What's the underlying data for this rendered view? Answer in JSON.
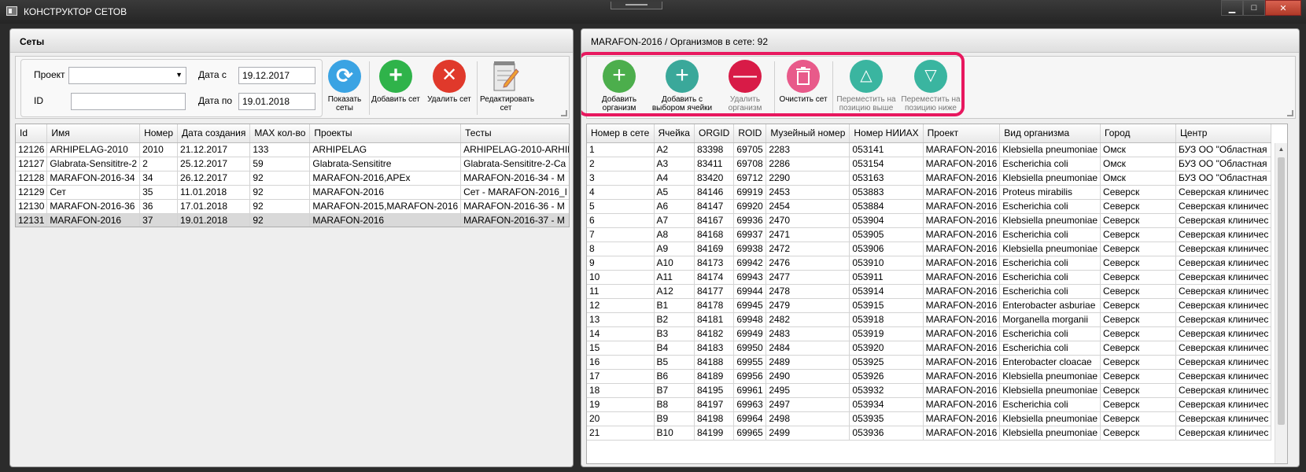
{
  "window": {
    "title": "КОНСТРУКТОР СЕТОВ",
    "controls": {
      "minimize": "▁",
      "maximize": "□",
      "close": "✕"
    }
  },
  "left_panel": {
    "title": "Сеты",
    "filters": {
      "project_label": "Проект",
      "project_value": "",
      "id_label": "ID",
      "id_value": "",
      "date_from_label": "Дата с",
      "date_from_value": "19.12.2017",
      "date_to_label": "Дата по",
      "date_to_value": "19.01.2018"
    },
    "buttons": {
      "show": "Показать сеты",
      "add": "Добавить сет",
      "delete": "Удалить сет",
      "edit": "Редактировать сет"
    },
    "table": {
      "columns": [
        "Id",
        "Имя",
        "Номер",
        "Дата создания",
        "MAX кол-во",
        "Проекты",
        "Тесты"
      ],
      "rows": [
        [
          "12126",
          "ARHIPELAG-2010",
          "2010",
          "21.12.2017",
          "133",
          "ARHIPELAG",
          "ARHIPELAG-2010-ARHIPE"
        ],
        [
          "12127",
          "Glabrata-Sensititre-2",
          "2",
          "25.12.2017",
          "59",
          "Glabrata-Sensititre",
          "Glabrata-Sensititre-2-Ca"
        ],
        [
          "12128",
          "MARAFON-2016-34",
          "34",
          "26.12.2017",
          "92",
          "MARAFON-2016,APEx",
          "MARAFON-2016-34 - M"
        ],
        [
          "12129",
          "Сет",
          "35",
          "11.01.2018",
          "92",
          "MARAFON-2016",
          "Сет  - MARAFON-2016_I"
        ],
        [
          "12130",
          "MARAFON-2016-36",
          "36",
          "17.01.2018",
          "92",
          "MARAFON-2015,MARAFON-2016",
          "MARAFON-2016-36 - M"
        ],
        [
          "12131",
          "MARAFON-2016",
          "37",
          "19.01.2018",
          "92",
          "MARAFON-2016",
          "MARAFON-2016-37 - M"
        ]
      ],
      "selected_row": 5
    }
  },
  "right_panel": {
    "header_set": "MARAFON-2016",
    "header_count": "  / Организмов в сете: 92",
    "buttons": {
      "add_org": "Добавить организм",
      "add_cell": "Добавить с выбором ячейки",
      "delete_org": "Удалить организм",
      "clear": "Очистить сет",
      "move_up": "Переместить на позицию выше",
      "move_down": "Переместить на позицию ниже"
    },
    "table": {
      "columns": [
        "Номер в сете",
        "Ячейка",
        "ORGID",
        "ROID",
        "Музейный номер",
        "Номер НИИАХ",
        "Проект",
        "Вид организма",
        "Город",
        "Центр"
      ],
      "rows": [
        [
          "1",
          "A2",
          "83398",
          "69705",
          "2283",
          "053141",
          "MARAFON-2016",
          "Klebsiella pneumoniae",
          "Омск",
          "БУЗ ОО \"Областная"
        ],
        [
          "2",
          "A3",
          "83411",
          "69708",
          "2286",
          "053154",
          "MARAFON-2016",
          "Escherichia coli",
          "Омск",
          "БУЗ ОО \"Областная"
        ],
        [
          "3",
          "A4",
          "83420",
          "69712",
          "2290",
          "053163",
          "MARAFON-2016",
          "Klebsiella pneumoniae",
          "Омск",
          "БУЗ ОО \"Областная"
        ],
        [
          "4",
          "A5",
          "84146",
          "69919",
          "2453",
          "053883",
          "MARAFON-2016",
          "Proteus mirabilis",
          "Северск",
          "Северская клиничес"
        ],
        [
          "5",
          "A6",
          "84147",
          "69920",
          "2454",
          "053884",
          "MARAFON-2016",
          "Escherichia coli",
          "Северск",
          "Северская клиничес"
        ],
        [
          "6",
          "A7",
          "84167",
          "69936",
          "2470",
          "053904",
          "MARAFON-2016",
          "Klebsiella pneumoniae",
          "Северск",
          "Северская клиничес"
        ],
        [
          "7",
          "A8",
          "84168",
          "69937",
          "2471",
          "053905",
          "MARAFON-2016",
          "Escherichia coli",
          "Северск",
          "Северская клиничес"
        ],
        [
          "8",
          "A9",
          "84169",
          "69938",
          "2472",
          "053906",
          "MARAFON-2016",
          "Klebsiella pneumoniae",
          "Северск",
          "Северская клиничес"
        ],
        [
          "9",
          "A10",
          "84173",
          "69942",
          "2476",
          "053910",
          "MARAFON-2016",
          "Escherichia coli",
          "Северск",
          "Северская клиничес"
        ],
        [
          "10",
          "A11",
          "84174",
          "69943",
          "2477",
          "053911",
          "MARAFON-2016",
          "Escherichia coli",
          "Северск",
          "Северская клиничес"
        ],
        [
          "11",
          "A12",
          "84177",
          "69944",
          "2478",
          "053914",
          "MARAFON-2016",
          "Escherichia coli",
          "Северск",
          "Северская клиничес"
        ],
        [
          "12",
          "B1",
          "84178",
          "69945",
          "2479",
          "053915",
          "MARAFON-2016",
          "Enterobacter asburiae",
          "Северск",
          "Северская клиничес"
        ],
        [
          "13",
          "B2",
          "84181",
          "69948",
          "2482",
          "053918",
          "MARAFON-2016",
          "Morganella morganii",
          "Северск",
          "Северская клиничес"
        ],
        [
          "14",
          "B3",
          "84182",
          "69949",
          "2483",
          "053919",
          "MARAFON-2016",
          "Escherichia coli",
          "Северск",
          "Северская клиничес"
        ],
        [
          "15",
          "B4",
          "84183",
          "69950",
          "2484",
          "053920",
          "MARAFON-2016",
          "Escherichia coli",
          "Северск",
          "Северская клиничес"
        ],
        [
          "16",
          "B5",
          "84188",
          "69955",
          "2489",
          "053925",
          "MARAFON-2016",
          "Enterobacter cloacae",
          "Северск",
          "Северская клиничес"
        ],
        [
          "17",
          "B6",
          "84189",
          "69956",
          "2490",
          "053926",
          "MARAFON-2016",
          "Klebsiella pneumoniae",
          "Северск",
          "Северская клиничес"
        ],
        [
          "18",
          "B7",
          "84195",
          "69961",
          "2495",
          "053932",
          "MARAFON-2016",
          "Klebsiella pneumoniae",
          "Северск",
          "Северская клиничес"
        ],
        [
          "19",
          "B8",
          "84197",
          "69963",
          "2497",
          "053934",
          "MARAFON-2016",
          "Escherichia coli",
          "Северск",
          "Северская клиничес"
        ],
        [
          "20",
          "B9",
          "84198",
          "69964",
          "2498",
          "053935",
          "MARAFON-2016",
          "Klebsiella pneumoniae",
          "Северск",
          "Северская клиничес"
        ],
        [
          "21",
          "B10",
          "84199",
          "69965",
          "2499",
          "053936",
          "MARAFON-2016",
          "Klebsiella pneumoniae",
          "Северск",
          "Северская клиничес"
        ]
      ]
    }
  },
  "colors": {
    "show_button": "#3aa3e3",
    "add_button": "#2fb34a",
    "delete_button": "#e0392b",
    "add_org": "#4cae4c",
    "add_cell": "#3aa89a",
    "delete_org": "#d81b47",
    "clear": "#e85a8a",
    "move": "#3ab5a0",
    "highlight": "#e8185f"
  }
}
